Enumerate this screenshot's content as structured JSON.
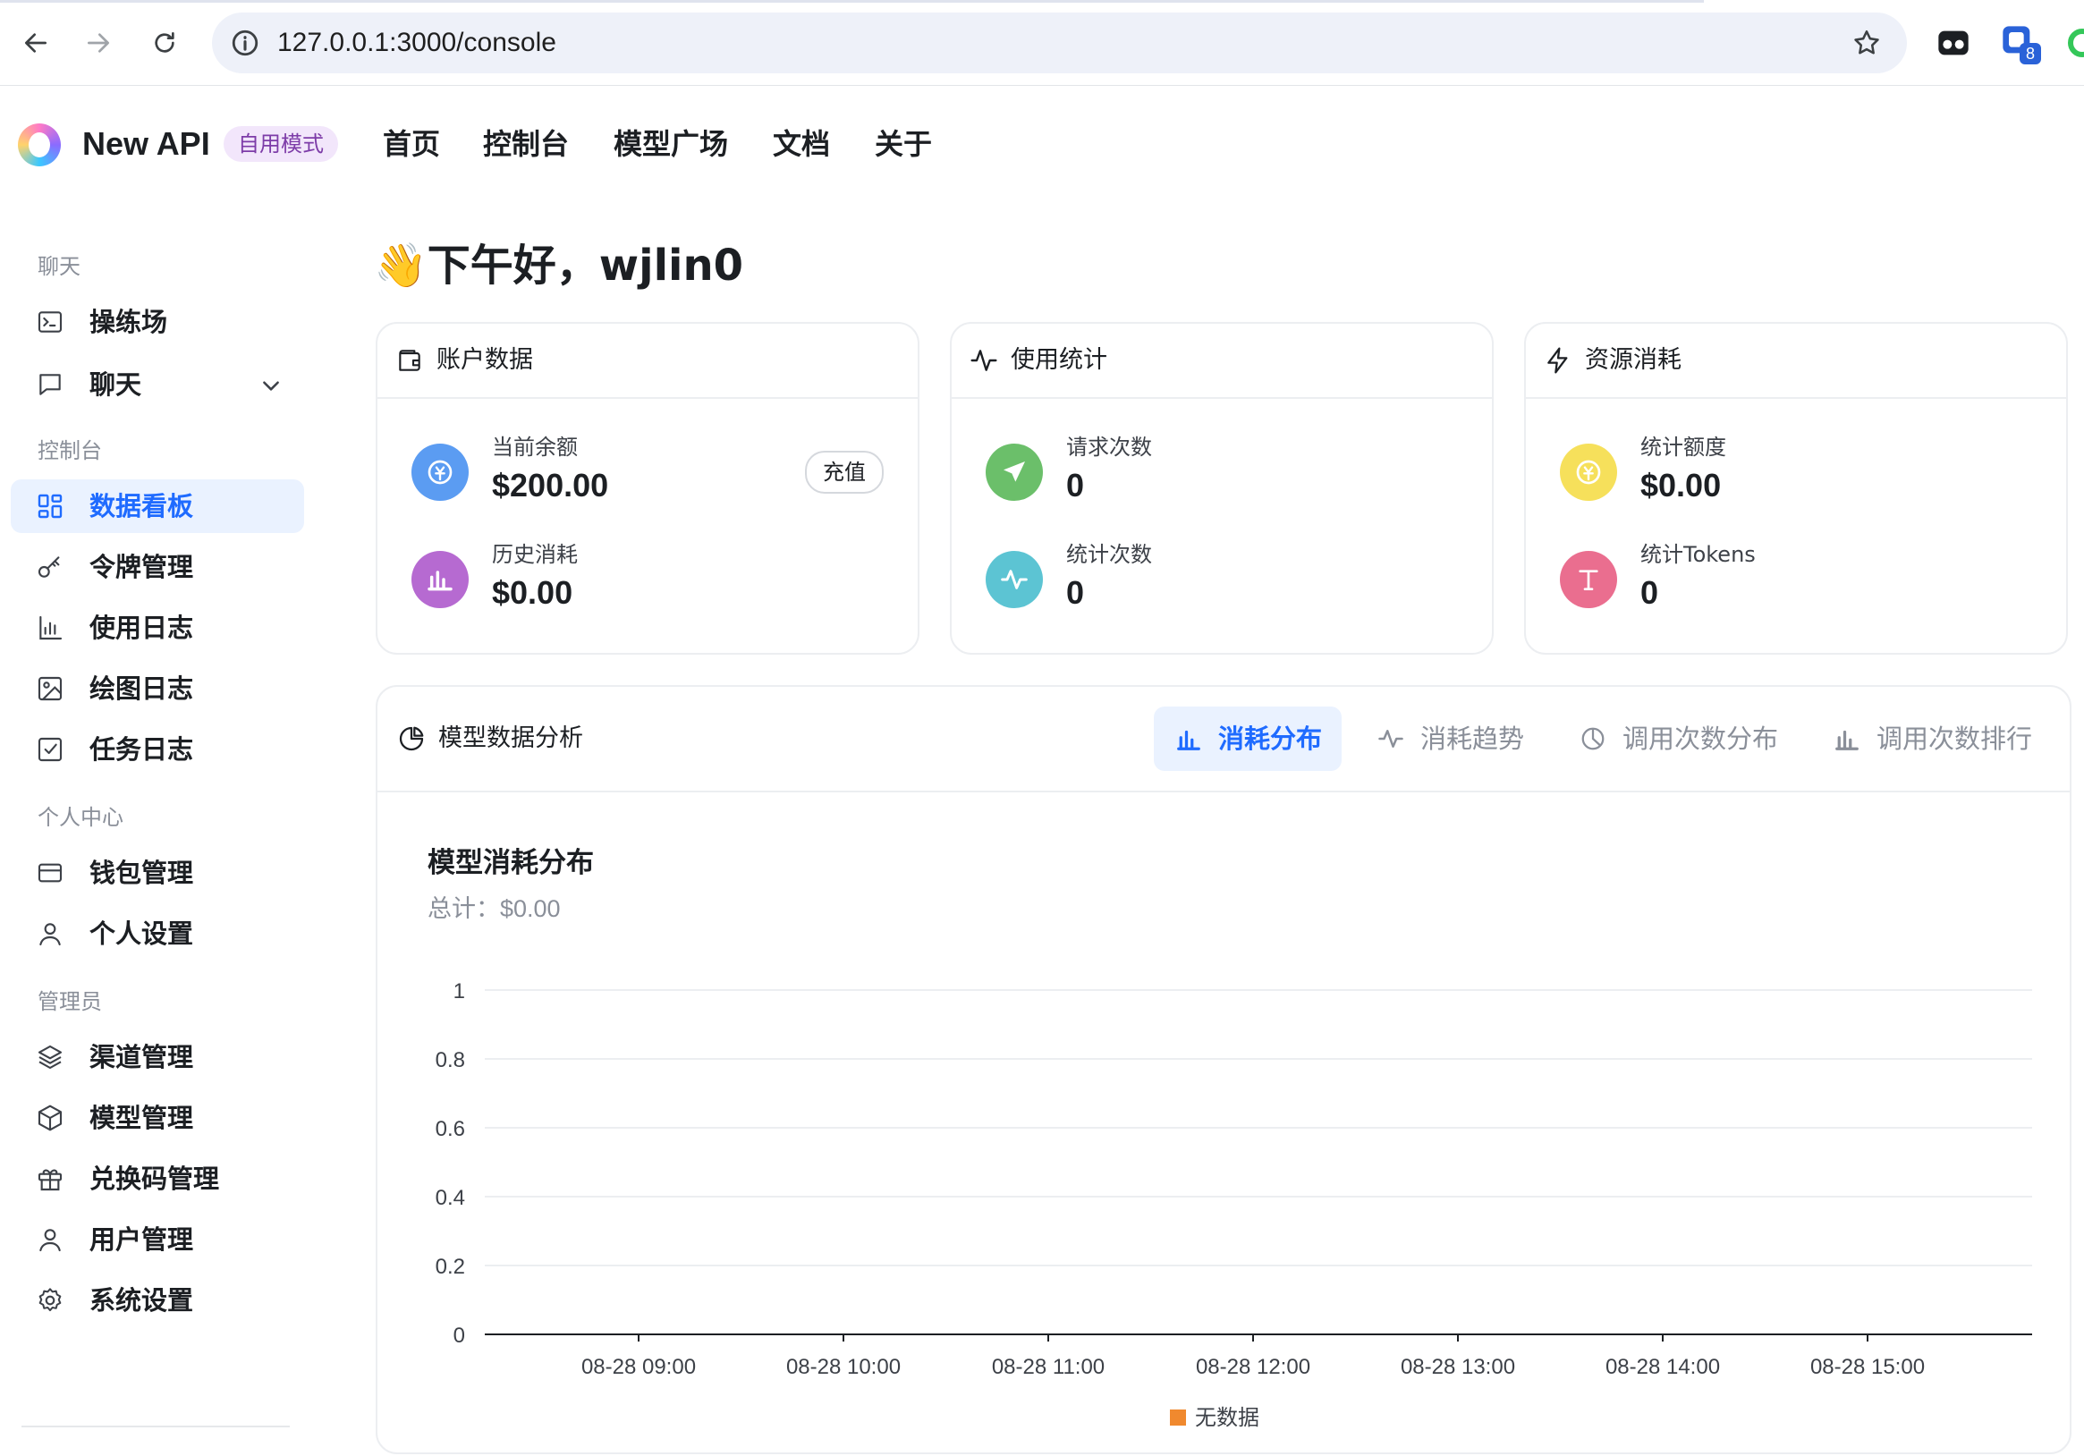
{
  "browser": {
    "url": "127.0.0.1:3000/console",
    "extension_badge": "8"
  },
  "header": {
    "brand": "New API",
    "mode_badge": "自用模式",
    "nav": [
      "首页",
      "控制台",
      "模型广场",
      "文档",
      "关于"
    ]
  },
  "sidebar": {
    "sections": [
      {
        "label": "聊天",
        "items": [
          {
            "label": "操练场",
            "icon": "terminal-icon"
          },
          {
            "label": "聊天",
            "icon": "chat-bubble-icon",
            "expandable": true
          }
        ]
      },
      {
        "label": "控制台",
        "items": [
          {
            "label": "数据看板",
            "icon": "dashboard-grid-icon",
            "active": true
          },
          {
            "label": "令牌管理",
            "icon": "key-icon"
          },
          {
            "label": "使用日志",
            "icon": "bar-chart-icon"
          },
          {
            "label": "绘图日志",
            "icon": "image-icon"
          },
          {
            "label": "任务日志",
            "icon": "checkbox-icon"
          }
        ]
      },
      {
        "label": "个人中心",
        "items": [
          {
            "label": "钱包管理",
            "icon": "credit-card-icon"
          },
          {
            "label": "个人设置",
            "icon": "user-icon"
          }
        ]
      },
      {
        "label": "管理员",
        "items": [
          {
            "label": "渠道管理",
            "icon": "layers-icon"
          },
          {
            "label": "模型管理",
            "icon": "box-icon"
          },
          {
            "label": "兑换码管理",
            "icon": "gift-icon"
          },
          {
            "label": "用户管理",
            "icon": "user-icon"
          },
          {
            "label": "系统设置",
            "icon": "gear-icon"
          }
        ]
      }
    ]
  },
  "greeting": "👋下午好，wjlin0",
  "cards": [
    {
      "title": "账户数据",
      "icon": "wallet-icon",
      "metrics": [
        {
          "label": "当前余额",
          "value": "$200.00",
          "color": "#5b9cf2",
          "icon": "coin-icon"
        },
        {
          "label": "历史消耗",
          "value": "$0.00",
          "color": "#b66ad1",
          "icon": "bar-chart-icon"
        }
      ],
      "action": "充值"
    },
    {
      "title": "使用统计",
      "icon": "pulse-icon",
      "metrics": [
        {
          "label": "请求次数",
          "value": "0",
          "color": "#6bbf6a",
          "icon": "send-icon"
        },
        {
          "label": "统计次数",
          "value": "0",
          "color": "#5cc4d3",
          "icon": "pulse-icon"
        }
      ]
    },
    {
      "title": "资源消耗",
      "icon": "lightning-icon",
      "metrics": [
        {
          "label": "统计额度",
          "value": "$0.00",
          "color": "#f6e05b",
          "icon": "coin-icon"
        },
        {
          "label": "统计Tokens",
          "value": "0",
          "color": "#ea6e8f",
          "icon": "text-t-icon"
        }
      ]
    }
  ],
  "analysis": {
    "title": "模型数据分析",
    "tabs": [
      {
        "label": "消耗分布",
        "icon": "bar-chart-icon",
        "active": true
      },
      {
        "label": "消耗趋势",
        "icon": "pulse-icon"
      },
      {
        "label": "调用次数分布",
        "icon": "pie-chart-icon"
      },
      {
        "label": "调用次数排行",
        "icon": "bar-chart-icon"
      }
    ],
    "chart_title": "模型消耗分布",
    "total_label": "总计：",
    "total_value": "$0.00"
  },
  "chart_data": {
    "type": "bar",
    "title": "模型消耗分布",
    "subtitle": "总计：$0.00",
    "categories": [
      "08-28 09:00",
      "08-28 10:00",
      "08-28 11:00",
      "08-28 12:00",
      "08-28 13:00",
      "08-28 14:00",
      "08-28 15:00"
    ],
    "series": [
      {
        "name": "无数据",
        "color": "#f0892e",
        "values": [
          0,
          0,
          0,
          0,
          0,
          0,
          0
        ]
      }
    ],
    "ylim": [
      0,
      1
    ],
    "yticks": [
      "0",
      "0.2",
      "0.4",
      "0.6",
      "0.8",
      "1"
    ],
    "grid": true,
    "legend": "bottom-center"
  },
  "colors": {
    "accent": "#1f6bff",
    "active_bg": "#eaf2ff",
    "muted_text": "#8a8f99"
  }
}
